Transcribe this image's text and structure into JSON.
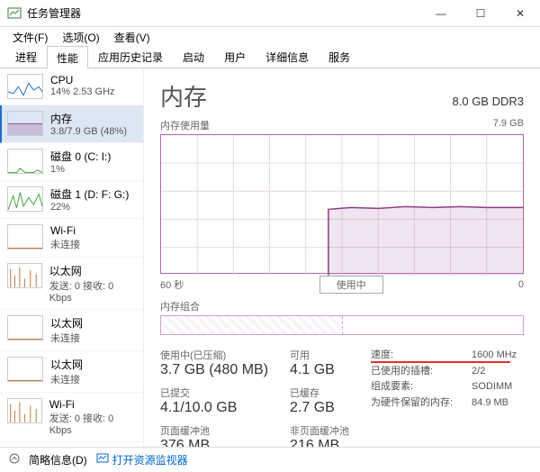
{
  "window": {
    "title": "任务管理器",
    "min": "—",
    "max": "☐",
    "close": "✕"
  },
  "menu": [
    "文件(F)",
    "选项(O)",
    "查看(V)"
  ],
  "tabs": [
    "进程",
    "性能",
    "应用历史记录",
    "启动",
    "用户",
    "详细信息",
    "服务"
  ],
  "sidebar": [
    {
      "name": "CPU",
      "sub": "14%  2.53 GHz",
      "color": "#1a6fc9",
      "pattern": "cpu"
    },
    {
      "name": "内存",
      "sub": "3.8/7.9 GB (48%)",
      "color": "#8a3e8a",
      "pattern": "mem",
      "selected": true
    },
    {
      "name": "磁盘 0 (C: I:)",
      "sub": "1%",
      "color": "#3a9e3a",
      "pattern": "low"
    },
    {
      "name": "磁盘 1 (D: F: G:)",
      "sub": "22%",
      "color": "#3a9e3a",
      "pattern": "disk"
    },
    {
      "name": "Wi-Fi",
      "sub": "未连接",
      "color": "#b86b2b",
      "pattern": "flat"
    },
    {
      "name": "以太网",
      "sub": "发送: 0 接收: 0 Kbps",
      "color": "#b86b2b",
      "pattern": "spikes"
    },
    {
      "name": "以太网",
      "sub": "未连接",
      "color": "#b86b2b",
      "pattern": "flat"
    },
    {
      "name": "以太网",
      "sub": "未连接",
      "color": "#b86b2b",
      "pattern": "flat"
    },
    {
      "name": "Wi-Fi",
      "sub": "发送: 0 接收: 0 Kbps",
      "color": "#b86b2b",
      "pattern": "spikes"
    }
  ],
  "main": {
    "title": "内存",
    "capacity": "8.0 GB DDR3",
    "usage_label": "内存使用量",
    "usage_max": "7.9 GB",
    "xaxis_left": "60 秒",
    "xaxis_right": "0",
    "inuse_label": "使用中",
    "comp_label": "内存组合"
  },
  "stats_left": [
    {
      "lbl": "使用中(已压缩)",
      "val": "3.7 GB (480 MB)"
    },
    {
      "lbl": "可用",
      "val": "4.1 GB"
    },
    {
      "lbl": "已提交",
      "val": "4.1/10.0 GB"
    },
    {
      "lbl": "已缓存",
      "val": "2.7 GB"
    },
    {
      "lbl": "页面缓冲池",
      "val": "376 MB"
    },
    {
      "lbl": "非页面缓冲池",
      "val": "216 MB"
    }
  ],
  "stats_right": [
    {
      "key": "速度:",
      "val": "1600 MHz",
      "highlight": true
    },
    {
      "key": "已使用的插槽:",
      "val": "2/2"
    },
    {
      "key": "组成要素:",
      "val": "SODIMM"
    },
    {
      "key": "为硬件保留的内存:",
      "val": "84.9 MB"
    }
  ],
  "footer": {
    "fewer": "简略信息(D)",
    "resmon": "打开资源监视器"
  },
  "chart_data": {
    "type": "area",
    "title": "内存使用量",
    "xlabel": "60 秒 → 0",
    "ylabel": "GB",
    "ylim": [
      0,
      7.9
    ],
    "x_seconds": [
      60,
      55,
      50,
      45,
      40,
      35,
      30,
      25,
      20,
      15,
      10,
      5,
      0
    ],
    "values_gb": [
      0,
      0,
      0,
      0,
      0,
      0,
      3.7,
      3.72,
      3.68,
      3.71,
      3.7,
      3.72,
      3.7
    ],
    "note": "左半段无数据(刚打开)，右半段约稳定在 3.7 GB / 48%"
  }
}
